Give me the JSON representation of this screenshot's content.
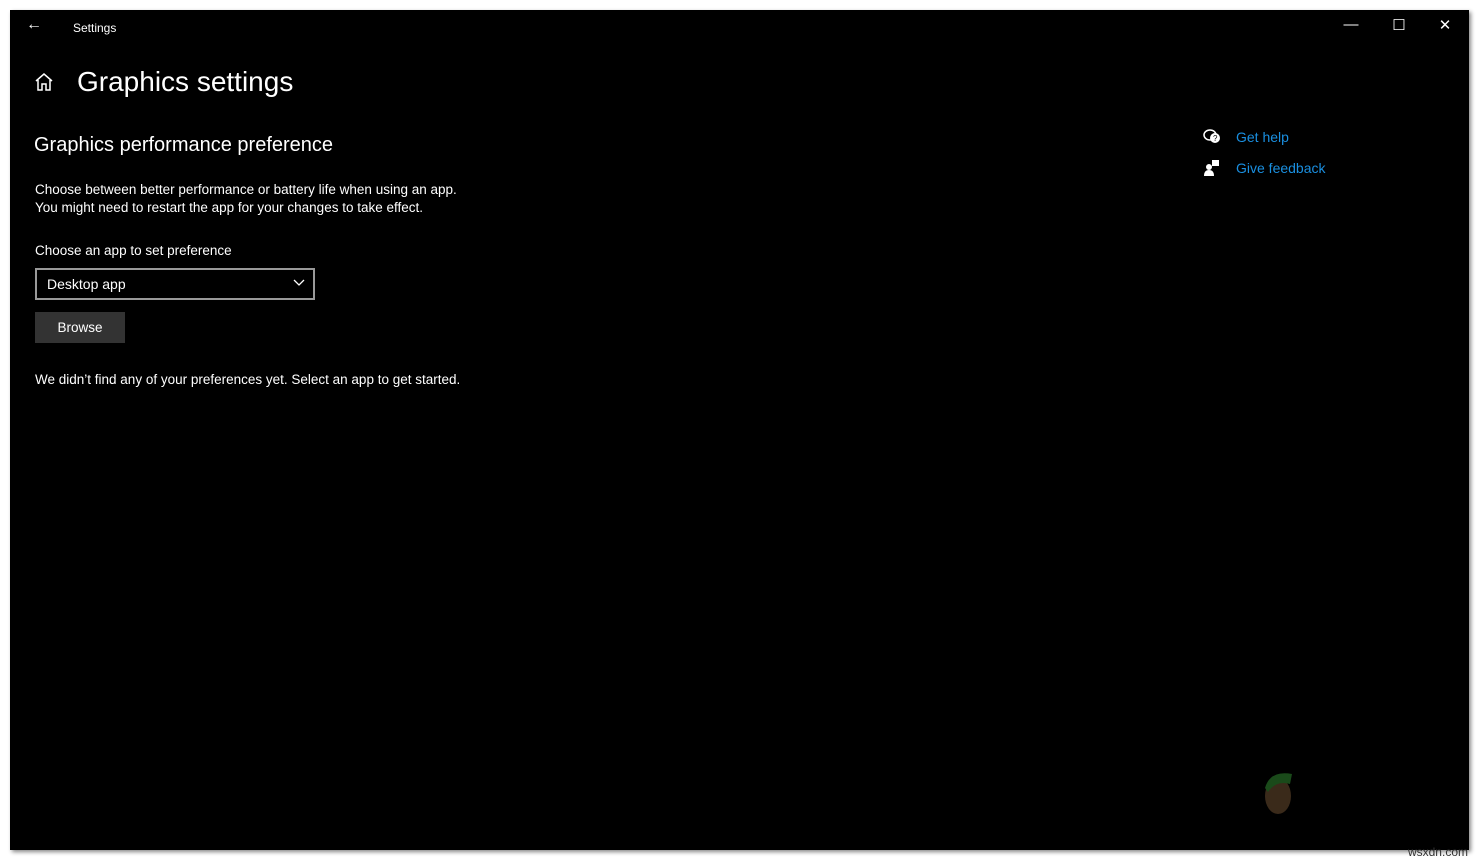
{
  "window": {
    "title": "Settings"
  },
  "page": {
    "title": "Graphics settings"
  },
  "section": {
    "title": "Graphics performance preference",
    "desc1": "Choose between better performance or battery life when using an app.",
    "desc2": "You might need to restart the app for your changes to take effect.",
    "choose_label": "Choose an app to set preference",
    "dropdown_value": "Desktop app",
    "browse_label": "Browse",
    "empty_message": "We didn’t find any of your preferences yet. Select an app to get started."
  },
  "help": {
    "get_help": "Get help",
    "give_feedback": "Give feedback"
  },
  "colors": {
    "accent": "#1a8fe0",
    "background": "#000000"
  },
  "watermark": "wsxdn.com"
}
